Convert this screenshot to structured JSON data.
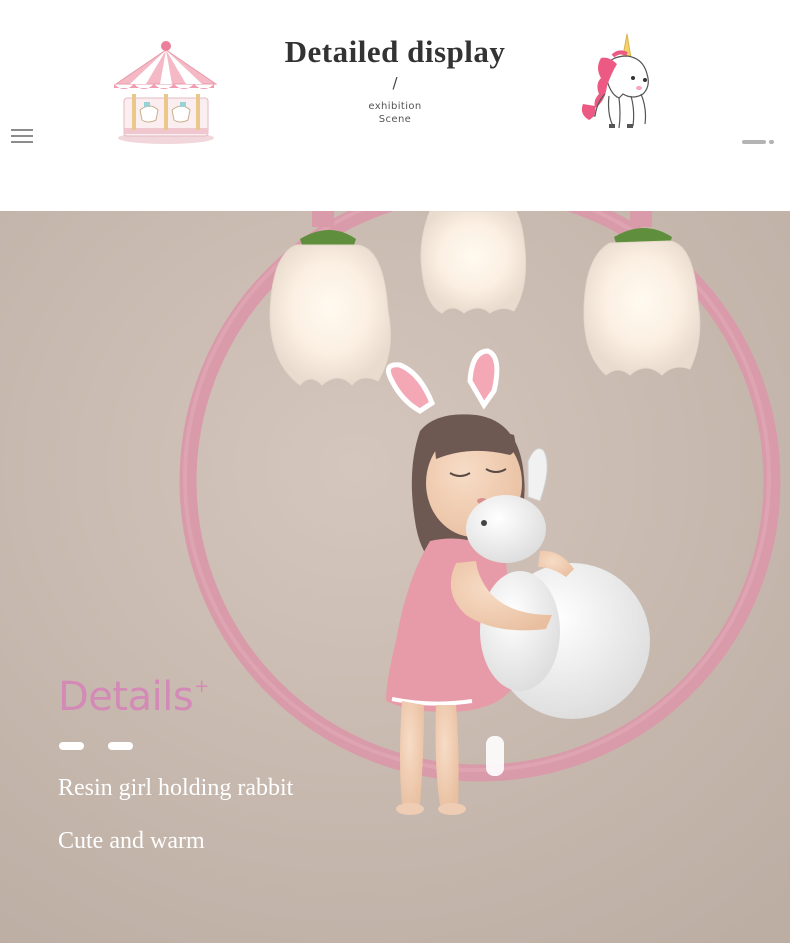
{
  "header": {
    "title": "Detailed display",
    "separator": "/",
    "subtitle_line1": "exhibition",
    "subtitle_line2": "Scene",
    "left_decoration_icon": "carousel-icon",
    "right_decoration_icon": "unicorn-icon",
    "menu_icon": "hamburger-menu-icon"
  },
  "pagination": {
    "total": 2,
    "active": 1
  },
  "overlay": {
    "heading": "Details",
    "heading_mark": "+",
    "line1": "Resin girl holding rabbit",
    "line2": "Cute and warm"
  },
  "colors": {
    "accent_pink": "#d38ab6",
    "ring_pink": "#d99aa9",
    "wall": "#cbbcb2",
    "text_dark": "#333333"
  }
}
